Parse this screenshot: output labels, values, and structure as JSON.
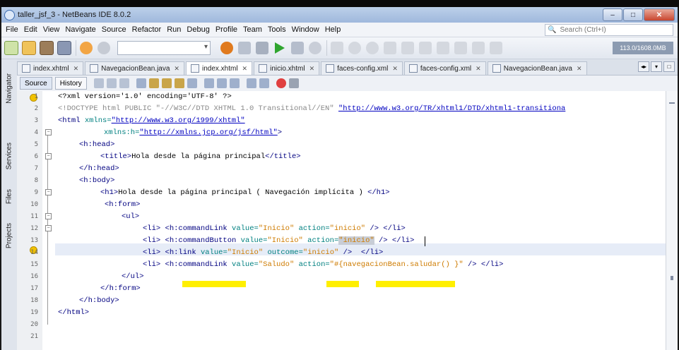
{
  "window": {
    "title": "taller_jsf_3 - NetBeans IDE 8.0.2",
    "minimize": "–",
    "maximize": "□",
    "close": "✕"
  },
  "menu": [
    "File",
    "Edit",
    "View",
    "Navigate",
    "Source",
    "Refactor",
    "Run",
    "Debug",
    "Profile",
    "Team",
    "Tools",
    "Window",
    "Help"
  ],
  "search": {
    "placeholder": "Search (Ctrl+I)"
  },
  "memory": "113.0/1608.0MB",
  "side_tabs": [
    "Navigator",
    "Services",
    "Files",
    "Projects"
  ],
  "tabs": [
    {
      "label": "index.xhtml",
      "active": false
    },
    {
      "label": "NavegacionBean.java",
      "active": false
    },
    {
      "label": "index.xhtml",
      "active": true
    },
    {
      "label": "inicio.xhtml",
      "active": false
    },
    {
      "label": "faces-config.xml",
      "active": false
    },
    {
      "label": "faces-config.xml",
      "active": false
    },
    {
      "label": "NavegacionBean.java",
      "active": false
    }
  ],
  "editor_tabs": {
    "source": "Source",
    "history": "History"
  },
  "lines": [
    "1",
    "2",
    "3",
    "4",
    "5",
    "6",
    "7",
    "8",
    "9",
    "10",
    "11",
    "12",
    "13",
    "14",
    "15",
    "16",
    "17",
    "18",
    "19",
    "20",
    "21"
  ],
  "code": {
    "l1": "<?xml version='1.0' encoding='UTF-8' ?>",
    "l2_a": "<!DOCTYPE html PUBLIC \"-//W3C//DTD XHTML 1.0 Transitional//EN\" ",
    "l2_url": "\"http://www.w3.org/TR/xhtml1/DTD/xhtml1-transitiona",
    "l3_tag": "<html ",
    "l3_attr": "xmlns=",
    "l3_val": "\"http://www.w3.org/1999/xhtml\"",
    "l4_attr": "xmlns:h=",
    "l4_val": "\"http://xmlns.jcp.org/jsf/html\"",
    "l4_end": ">",
    "l5": "<h:head>",
    "l6_a": "<title>",
    "l6_text": "Hola desde la página principal",
    "l6_b": "</title>",
    "l7": "</h:head>",
    "l8": "<h:body>",
    "l9_a": "<h1>",
    "l9_text": "Hola desde la página principal ( Navegación implícita ) ",
    "l9_b": "</h1>",
    "l10": "<h:form>",
    "l11": "<ul>",
    "l12_li": "<li> ",
    "l12_tag": "<h:commandLink ",
    "l12_a1": "value=",
    "l12_v1": "\"Inicio\" ",
    "l12_a2": "action=",
    "l12_v2": "\"inicio\"",
    "l12_end": " /> </li>",
    "l13_li": "<li> ",
    "l13_tag": "<h:commandButton ",
    "l13_a1": "value=",
    "l13_v1": "\"Inicio\" ",
    "l13_a2": "action=",
    "l13_v2": "\"inicio\"",
    "l13_end": " /> </li>",
    "l14_li": "<li> ",
    "l14_tag": "<h:link ",
    "l14_a1": "value=",
    "l14_v1": "\"Inicio\" ",
    "l14_a2": "outcome=",
    "l14_v2": "\"inicio\"",
    "l14_end": " />  </li>",
    "l15_li": "<li> ",
    "l15_tag": "<h:commandLink ",
    "l15_a1": "value=",
    "l15_v1": "\"Saludo\" ",
    "l15_a2": "action=",
    "l15_v2": "\"#{navegacionBean.saludar() }\"",
    "l15_end": " /> </li>",
    "l16": "</ul>",
    "l17": "</h:form>",
    "l18": "</h:body>",
    "l19": "</html>"
  }
}
